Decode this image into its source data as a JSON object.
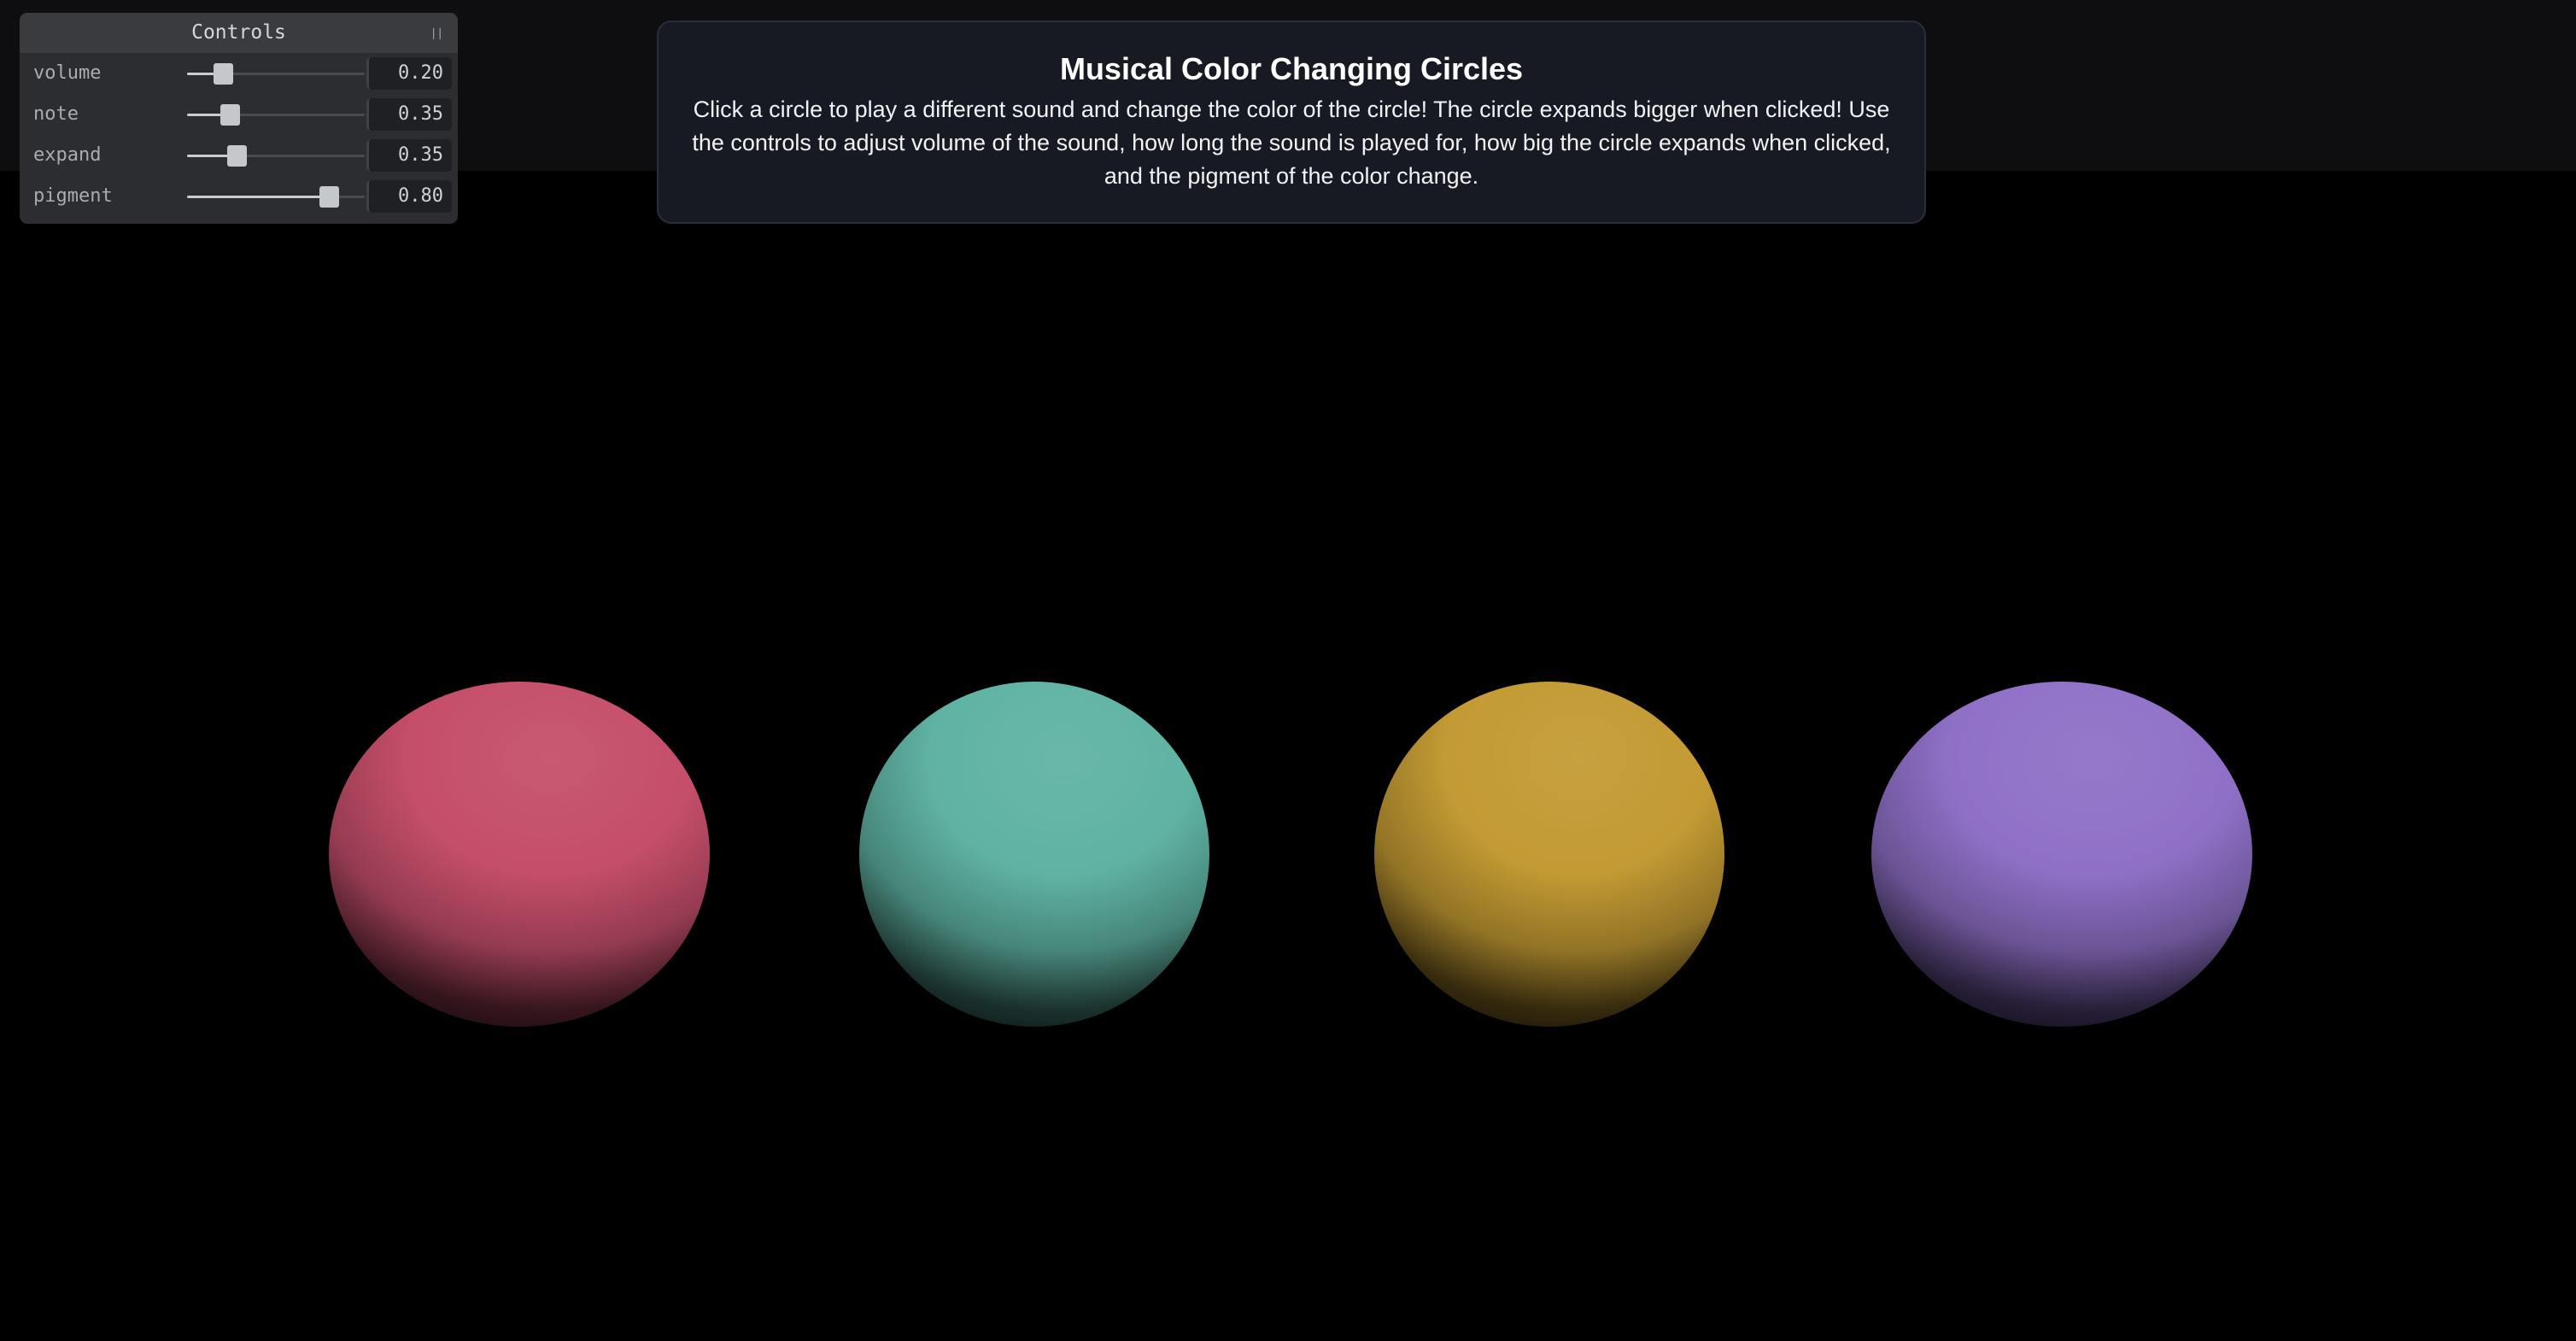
{
  "controls": {
    "title": "Controls",
    "collapse_icon": "collapse-icon",
    "sliders": [
      {
        "label": "volume",
        "value": "0.20",
        "fraction": 0.2
      },
      {
        "label": "note",
        "value": "0.35",
        "fraction": 0.24
      },
      {
        "label": "expand",
        "value": "0.35",
        "fraction": 0.28
      },
      {
        "label": "pigment",
        "value": "0.80",
        "fraction": 0.8
      }
    ]
  },
  "info": {
    "title": "Musical Color Changing Circles",
    "description": "Click a circle to play a different sound and change the color of the circle! The circle expands bigger when clicked! Use the controls to adjust volume of the sound, how long the sound is played for, how big the circle expands when clicked, and the pigment of the color change."
  },
  "circles": [
    {
      "color": "#c54e6a"
    },
    {
      "color": "#5fb3a3"
    },
    {
      "color": "#c39a33"
    },
    {
      "color": "#8f70c7"
    }
  ]
}
